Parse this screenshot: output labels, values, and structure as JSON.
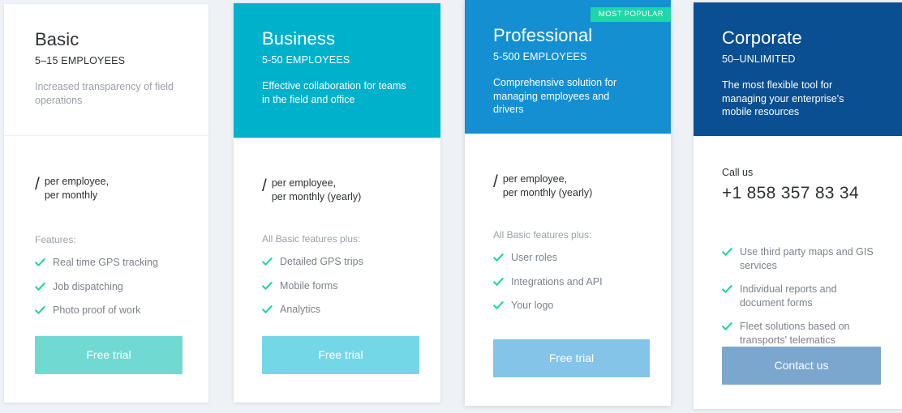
{
  "page": {
    "background_color": "#eef1f5",
    "check_icon_color": "#1fd6a8"
  },
  "plans": [
    {
      "id": "basic",
      "name": "Basic",
      "employees": "5–15 EMPLOYEES",
      "tagline": "Increased transparency of field operations",
      "header_color": "#ffffff",
      "price_amount": "",
      "price_slash": "/",
      "price_unit_line1": "per employee,",
      "price_unit_line2": "per monthly",
      "features_heading": "Features:",
      "features": [
        "Real time GPS tracking",
        "Job dispatching",
        "Photo proof of work"
      ],
      "cta_label": "Free trial",
      "cta_color": "#6fd9d2",
      "badge": null
    },
    {
      "id": "business",
      "name": "Business",
      "employees": "5-50 EMPLOYEES",
      "tagline": "Effective collaboration for teams in the field and office",
      "header_color": "#00b1cc",
      "price_amount": "",
      "price_slash": "/",
      "price_unit_line1": "per employee,",
      "price_unit_line2": "per monthly (yearly)",
      "features_heading": "All Basic features plus:",
      "features": [
        "Detailed GPS trips",
        "Mobile forms",
        "Analytics"
      ],
      "cta_label": "Free trial",
      "cta_color": "#74d7e8",
      "badge": null
    },
    {
      "id": "professional",
      "name": "Professional",
      "employees": "5-500 EMPLOYEES",
      "tagline": "Comprehensive solution for managing employees and drivers",
      "header_color": "#1490d2",
      "price_amount": "",
      "price_slash": "/",
      "price_unit_line1": "per employee,",
      "price_unit_line2": "per monthly (yearly)",
      "features_heading": "All Basic features plus:",
      "features": [
        "User roles",
        "Integrations and API",
        "Your logo"
      ],
      "cta_label": "Free trial",
      "cta_color": "#84c4e8",
      "badge": "MOST POPULAR",
      "badge_color": "#1fd6a8"
    },
    {
      "id": "corporate",
      "name": "Corporate",
      "employees": "50–UNLIMITED",
      "tagline": "The most flexible tool for managing your enterprise's mobile resources",
      "header_color": "#0a4f91",
      "call_label": "Call us",
      "phone": "+1 858 357 83 34",
      "features_heading": "",
      "features": [
        "Use third party maps and GIS services",
        "Individual reports and document forms",
        "Fleet solutions based on transports' telematics"
      ],
      "cta_label": "Contact us",
      "cta_color": "#7ba7cf",
      "badge": null
    }
  ]
}
